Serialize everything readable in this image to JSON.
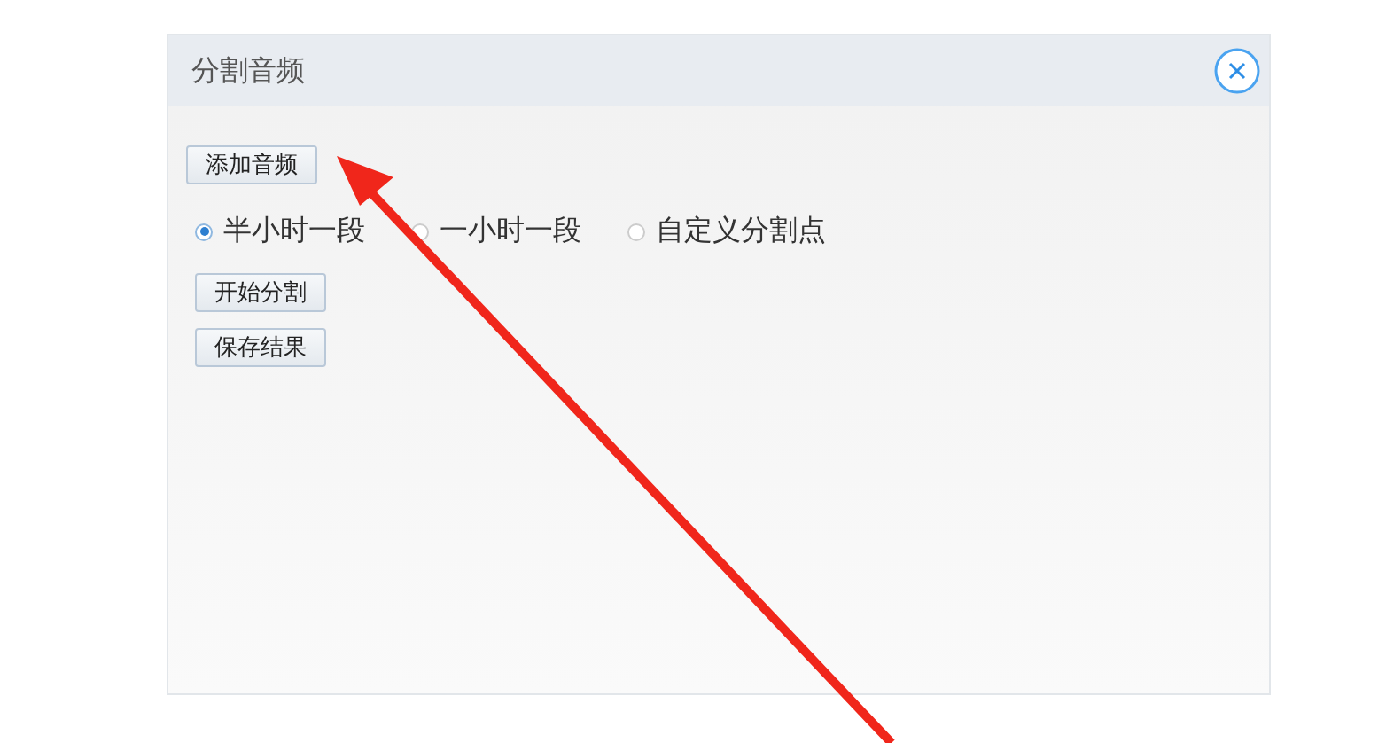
{
  "window": {
    "title": "分割音频"
  },
  "add_button": "添加音频",
  "options": [
    {
      "label": "半小时一段",
      "selected": true
    },
    {
      "label": "一小时一段",
      "selected": false
    },
    {
      "label": "自定义分割点",
      "selected": false
    }
  ],
  "buttons": [
    "开始分割",
    "保存结果"
  ],
  "annotation": {
    "kind": "arrow"
  }
}
